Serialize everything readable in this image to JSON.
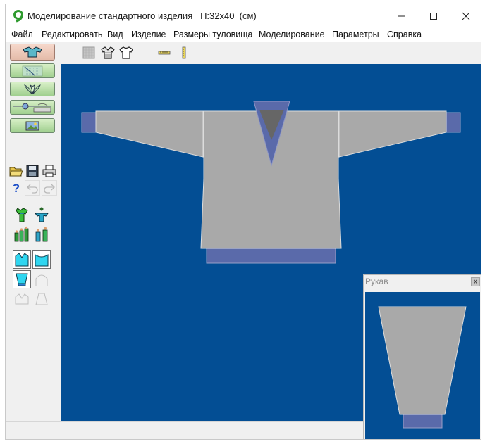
{
  "window": {
    "title": "Моделирование стандартного изделия   П:32x40  (см)",
    "controls": [
      "minimize",
      "maximize",
      "close"
    ]
  },
  "menu": [
    "Файл",
    "Редактировать",
    "Вид",
    "Изделие",
    "Размеры туловища",
    "Моделирование",
    "Параметры",
    "Справка"
  ],
  "toolbar_icons": [
    "grid-page-icon",
    "sweater-front-icon",
    "sweater-back-icon",
    "horizontal-ruler-icon",
    "vertical-ruler-icon"
  ],
  "left_toolbar": {
    "mode_buttons": [
      "sweater-mode-icon",
      "pattern-mode-icon",
      "leaves-mode-icon",
      "knitting-machine-icon",
      "image-icon"
    ],
    "file_buttons": [
      "open-folder-icon",
      "save-icon",
      "print-icon"
    ],
    "edit_buttons": [
      "help-icon",
      "undo-icon",
      "redo-icon"
    ]
  },
  "sleeve_panel": {
    "title": "Рукав",
    "close_label": "x"
  },
  "colors": {
    "canvas": "#034e94",
    "garment": "#a9a9a9",
    "trim": "#5a6aaa",
    "neck_hole": "#666666"
  }
}
